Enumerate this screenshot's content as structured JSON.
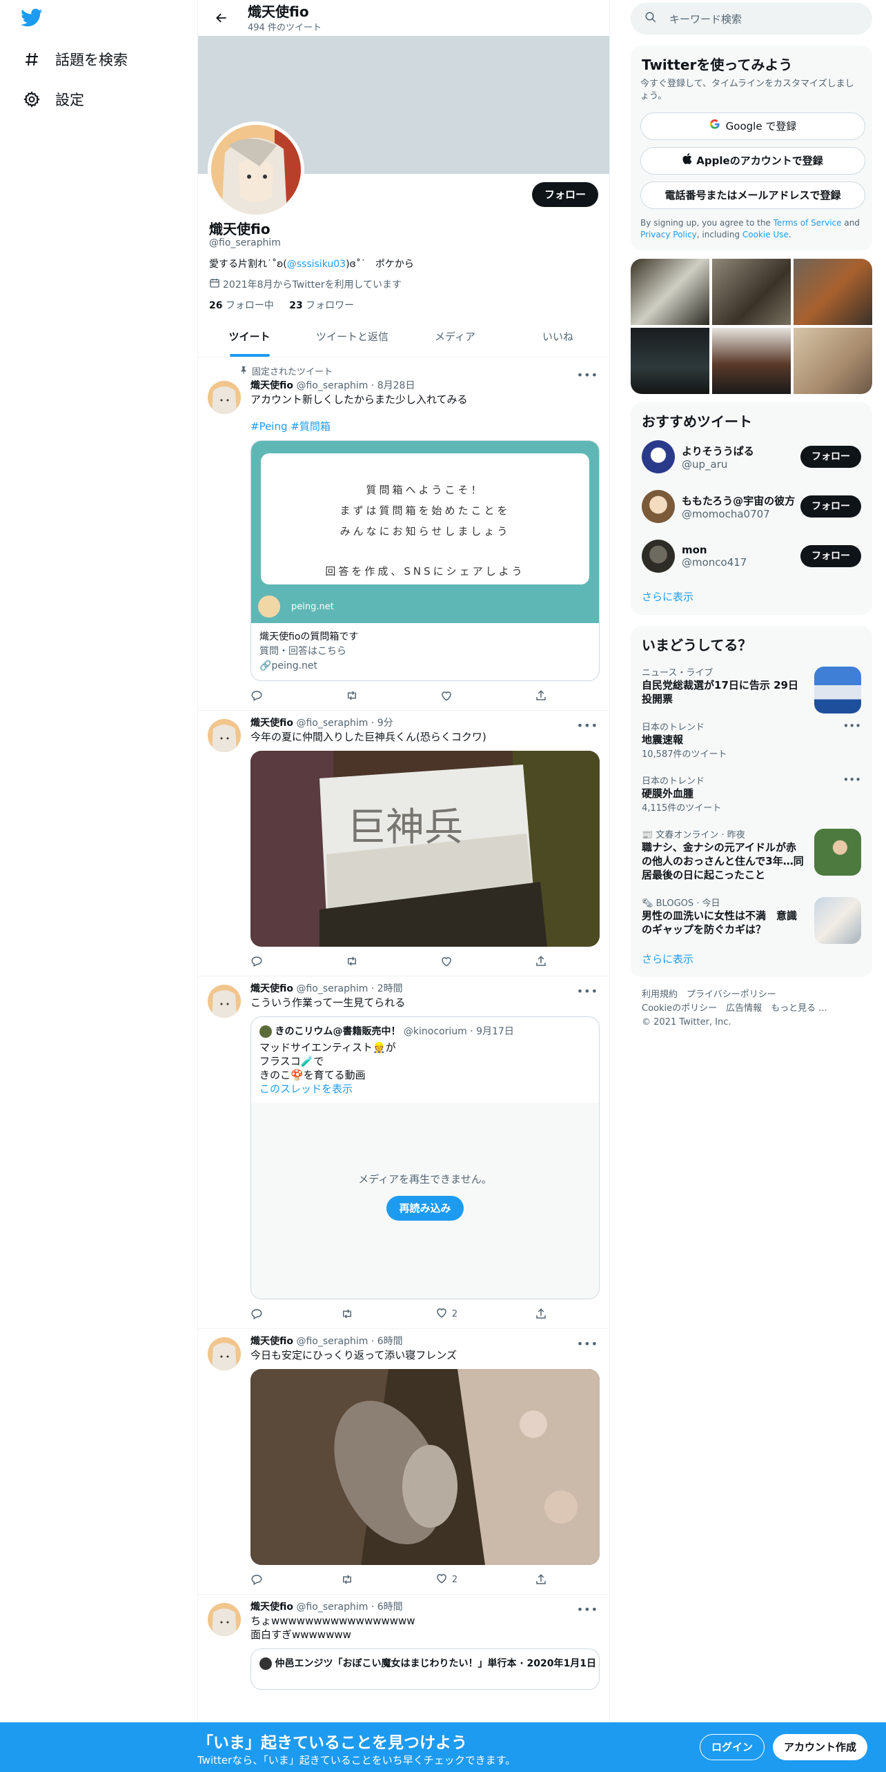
{
  "nav": {
    "explore_label": "話題を検索",
    "settings_label": "設定"
  },
  "header": {
    "title": "熾天使fio",
    "tweet_count": "494 件のツイート"
  },
  "profile": {
    "follow_label": "フォロー",
    "name": "熾天使fio",
    "handle": "@fio_seraphim",
    "bio_prefix": "愛する片割れ˙˚ʚ(",
    "bio_link": "@sssisiku03",
    "bio_suffix": ")ɞ˚˙　ポケから",
    "joined": "2021年8月からTwitterを利用しています",
    "following_count": "26",
    "following_label": "フォロー中",
    "followers_count": "23",
    "followers_label": "フォロワー"
  },
  "tabs": [
    "ツイート",
    "ツイートと返信",
    "メディア",
    "いいね"
  ],
  "tweets": [
    {
      "pinned_label": "固定されたツイート",
      "name": "熾天使fio",
      "meta": "@fio_seraphim · 8月28日",
      "text": "アカウント新しくしたからまた少し入れてみる",
      "tags": "#Peing #質問箱",
      "card": {
        "line1": "質問箱へようこそ！",
        "line2": "まずは質問箱を始めたことを",
        "line3": "みんなにお知らせしましょう",
        "line4": "回答を作成、SNSにシェアしよう",
        "site": "peing.net",
        "title": "熾天使fioの質問箱です",
        "desc": "質問・回答はこちら",
        "domain": "peing.net"
      }
    },
    {
      "name": "熾天使fio",
      "meta": "@fio_seraphim · 9分",
      "text": "今年の夏に仲間入りした巨神兵くん(恐らくコクワ)"
    },
    {
      "name": "熾天使fio",
      "meta": "@fio_seraphim · 2時間",
      "text": "こういう作業って一生見てられる",
      "quote": {
        "name": "きのこリウム@書籍販売中！",
        "meta": "@kinocorium · 9月17日",
        "line1": "マッドサイエンティスト👷が",
        "line2": "フラスコ🧪で",
        "line3": "きのこ🍄を育てる動画",
        "thread_link": "このスレッドを表示",
        "media_error": "メディアを再生できません。",
        "reload_label": "再読み込み"
      },
      "likes": "2"
    },
    {
      "name": "熾天使fio",
      "meta": "@fio_seraphim · 6時間",
      "text": "今日も安定にひっくり返って添い寝フレンズ",
      "likes": "2"
    },
    {
      "name": "熾天使fio",
      "meta": "@fio_seraphim · 6時間",
      "line1": "ちょwwwwwwwwwwwwwwwww",
      "line2": "面白すぎwwwwwww",
      "quote_preview": "仲邑エンジツ「おぼこい魔女はまじわりたい！」単行本 · 2020年1月1日"
    }
  ],
  "search": {
    "placeholder": "キーワード検索"
  },
  "signup": {
    "title": "Twitterを使ってみよう",
    "desc": "今すぐ登録して、タイムラインをカスタマイズしましょう。",
    "google": "Google で登録",
    "apple": "Appleのアカウントで登録",
    "phone": "電話番号またはメールアドレスで登録",
    "terms_prefix": "By signing up, you agree to the ",
    "terms_link": "Terms of Service",
    "terms_and": " and ",
    "privacy_link": "Privacy Policy",
    "terms_including": ", including ",
    "cookie_link": "Cookie Use",
    "terms_end": "."
  },
  "recommended": {
    "title": "おすすめツイート",
    "users": [
      {
        "name": "よりそううぱる",
        "handle": "@up_aru",
        "button": "フォロー"
      },
      {
        "name": "ももたろう@宇宙の彼方",
        "handle": "@momocha0707",
        "button": "フォロー"
      },
      {
        "name": "mon",
        "handle": "@monco417",
        "button": "フォロー"
      }
    ],
    "show_more": "さらに表示"
  },
  "trends": {
    "title": "いまどうしてる？",
    "items": [
      {
        "category": "ニュース・ライブ",
        "title": "自民党総裁選が17日に告示 29日投開票"
      },
      {
        "category": "日本のトレンド",
        "title": "地震速報",
        "count": "10,587件のツイート"
      },
      {
        "category": "日本のトレンド",
        "title": "硬膜外血腫",
        "count": "4,115件のツイート"
      },
      {
        "category": "文春オンライン · 昨夜",
        "title": "職ナシ、金ナシの元アイドルが赤の他人のおっさんと住んで3年…同居最後の日に起こったこと"
      },
      {
        "category": "BLOGOS · 今日",
        "title": "男性の皿洗いに女性は不満　意識のギャップを防ぐカギは？"
      }
    ],
    "show_more": "さらに表示"
  },
  "footer": {
    "line1": "利用規約　プライバシーポリシー",
    "line2": "Cookieのポリシー　広告情報　もっと見る ...",
    "line3": "© 2021 Twitter, Inc."
  },
  "bottom": {
    "title": "「いま」起きていることを見つけよう",
    "subtitle": "Twitterなら、「いま」起きていることをいち早くチェックできます。",
    "login": "ログイン",
    "signup": "アカウント作成"
  },
  "colors": {
    "accent": "#1d9bf0",
    "banner": "#cfd9de",
    "card": "#5fb7b5"
  }
}
